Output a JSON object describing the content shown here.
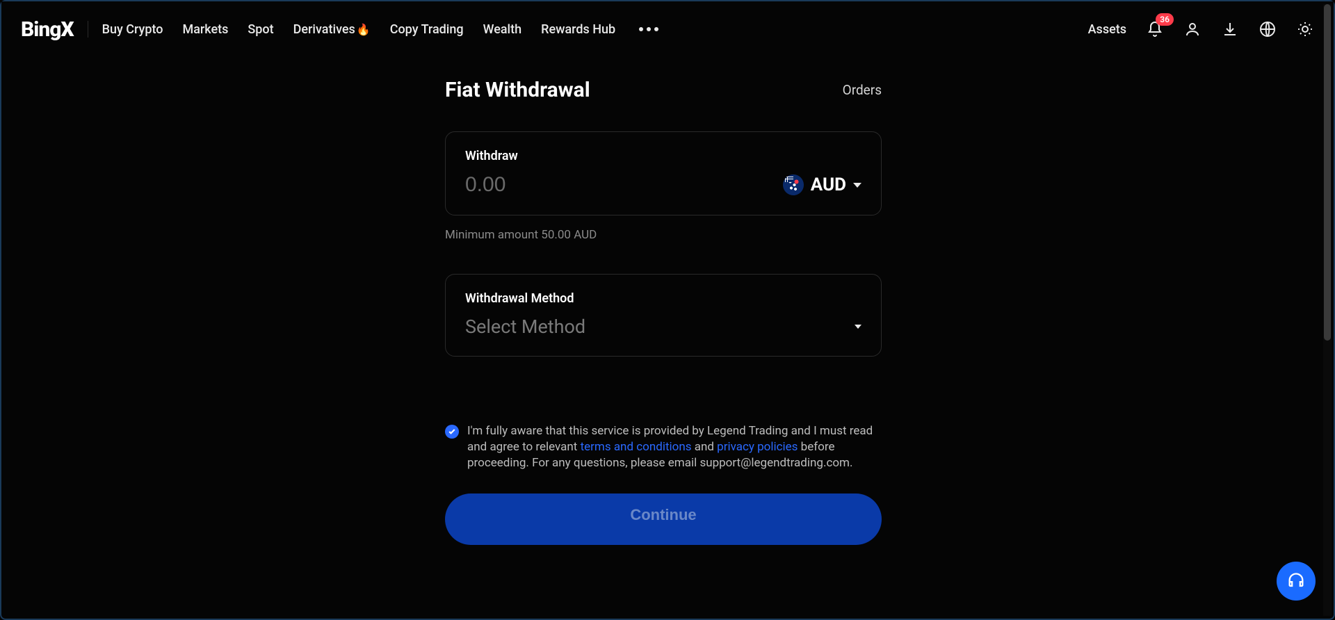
{
  "header": {
    "logo": "BingX",
    "nav": {
      "buy_crypto": "Buy Crypto",
      "markets": "Markets",
      "spot": "Spot",
      "derivatives": "Derivatives",
      "copy_trading": "Copy Trading",
      "wealth": "Wealth",
      "rewards_hub": "Rewards Hub"
    },
    "right": {
      "assets": "Assets",
      "notification_badge": "36"
    }
  },
  "page": {
    "title": "Fiat Withdrawal",
    "orders_link": "Orders"
  },
  "withdraw": {
    "label": "Withdraw",
    "amount_placeholder": "0.00",
    "currency_code": "AUD",
    "min_hint": "Minimum amount 50.00 AUD"
  },
  "method": {
    "label": "Withdrawal Method",
    "placeholder": "Select Method"
  },
  "agreement": {
    "part1": "I'm fully aware that this service is provided by Legend Trading and I must read and agree to relevant ",
    "terms": "terms and conditions",
    "and": " and ",
    "privacy": "privacy policies",
    "part2": " before proceeding. For any questions, please email support@legendtrading.com."
  },
  "continue_label": "Continue"
}
